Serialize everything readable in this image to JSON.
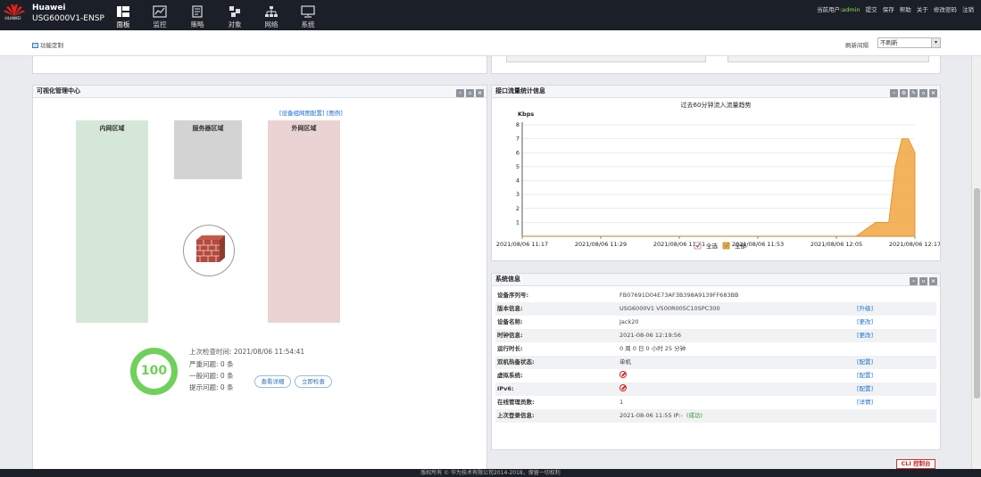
{
  "brand": {
    "logo_text": "HUAWEI",
    "name": "Huawei",
    "model": "USG6000V1-ENSP"
  },
  "nav": [
    {
      "label": "面板",
      "icon": "dashboard-icon",
      "active": true
    },
    {
      "label": "监控",
      "icon": "monitor-chart-icon",
      "active": false
    },
    {
      "label": "策略",
      "icon": "policy-document-icon",
      "active": false
    },
    {
      "label": "对象",
      "icon": "object-blocks-icon",
      "active": false
    },
    {
      "label": "网络",
      "icon": "network-topology-icon",
      "active": false
    },
    {
      "label": "系统",
      "icon": "system-monitor-icon",
      "active": false
    }
  ],
  "top_links": {
    "current_user_label": "当前用户:",
    "user": "admin",
    "commit": "提交",
    "save": "保存",
    "help": "帮助",
    "about": "关于",
    "change_password": "修改密码",
    "logout": "注销"
  },
  "subbar": {
    "func_custom": "功能定制",
    "refresh_label": "刷新间隔",
    "refresh_value": "不刷新"
  },
  "vis_panel": {
    "title": "可视化管理中心",
    "link_config": "[设备组网图配置]",
    "link_legend": "[图例]",
    "zone_inner": "内网区域",
    "zone_server": "服务器区域",
    "zone_outer": "外网区域",
    "score": "100",
    "last_check": "上次检查时间:  2021/08/06 11:54:41",
    "severe": "严重问题:  0  条",
    "general": "一般问题:  0  条",
    "hint": "提示问题:  0  条",
    "view_detail": "查看详细",
    "check_now": "立即检查"
  },
  "traffic_panel": {
    "title": "接口流量统计信息"
  },
  "chart_data": {
    "type": "area",
    "title": "过去60分钟流入流量趋势",
    "ylabel": "Kbps",
    "ylim": [
      0,
      8
    ],
    "y_ticks": [
      "1",
      "2",
      "3",
      "4",
      "5",
      "6",
      "7",
      "8"
    ],
    "x_ticks": [
      "2021/08/06 11:17",
      "2021/08/06 11:29",
      "2021/08/06 11:41",
      "2021/08/06 11:53",
      "2021/08/06 12:05",
      "2021/08/06 12:17"
    ],
    "x_range_minutes": [
      0,
      60
    ],
    "series": [
      {
        "name": "全部",
        "color": "#f0a640",
        "x_minutes": [
          0,
          48,
          51,
          54,
          56,
          57,
          58,
          59,
          60
        ],
        "values": [
          0,
          0,
          0,
          1,
          1,
          5,
          7,
          7,
          6
        ]
      }
    ],
    "legend": [
      {
        "label": "全选",
        "checked": true
      },
      {
        "label": "全部",
        "checked": true,
        "color": "#f0a640"
      }
    ]
  },
  "sysinfo": {
    "title": "系统信息",
    "rows": [
      {
        "label": "设备序列号:",
        "value": "FB07691D04E73AF3B398A9139FF683BB",
        "link": ""
      },
      {
        "label": "版本信息:",
        "value": "USG6000V1 V500R005C10SPC300",
        "link": "[升级]"
      },
      {
        "label": "设备名称:",
        "value": "Jack20",
        "link": "[更改]"
      },
      {
        "label": "时钟信息:",
        "value": "2021-08-06 12:19:56",
        "link": "[更改]"
      },
      {
        "label": "运行时长:",
        "value": "0 周 0 日 0 小时 25 分钟",
        "link": ""
      },
      {
        "label": "双机热备状态:",
        "value": "单机",
        "link": "[配置]"
      },
      {
        "label": "虚拟系统:",
        "value": "",
        "link": "[配置]",
        "icon": "disabled-icon"
      },
      {
        "label": "IPv6:",
        "value": "",
        "link": "[配置]",
        "icon": "disabled-icon"
      },
      {
        "label": "在线管理员数:",
        "value": "1",
        "link": "[详情]"
      },
      {
        "label": "上次登录信息:",
        "value": "2021-08-06 11:55 IP:-",
        "link": "",
        "status": "(成功)"
      }
    ]
  },
  "cli": "CLI 控制台",
  "footer": "版权所有 © 华为技术有限公司2014-2018，保留一切权利"
}
